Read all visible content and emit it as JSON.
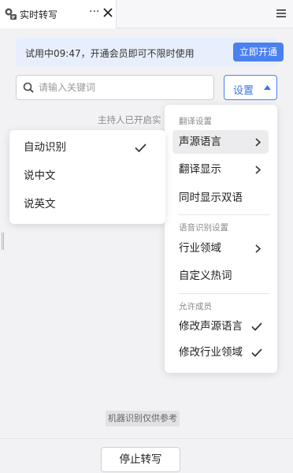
{
  "tab": {
    "icon": "transcription-icon",
    "title": "实时转写",
    "more": "···"
  },
  "banner": {
    "text": "试用中09:47，开通会员即可不限时使用",
    "button": "立即开通"
  },
  "search": {
    "placeholder": "请输入关键词"
  },
  "settings_button": "设置",
  "host_notice": "主持人已开启实",
  "dropdown": {
    "section_translate": "翻译设置",
    "source_language": "声源语言",
    "translation_display": "翻译显示",
    "bilingual": "同时显示双语",
    "section_asr": "语音识别设置",
    "industry": "行业领域",
    "hotwords": "自定义热词",
    "section_permissions": "允许成员",
    "modify_source_language": "修改声源语言",
    "modify_industry": "修改行业领域"
  },
  "submenu": {
    "items": [
      "自动识别",
      "说中文",
      "说英文"
    ],
    "selected": "自动识别"
  },
  "disclaimer": "机器识别仅供参考",
  "stop_button": "停止转写",
  "colors": {
    "accent": "#4a80f0",
    "banner_bg": "#e8effc",
    "background": "#f2f2f4"
  }
}
